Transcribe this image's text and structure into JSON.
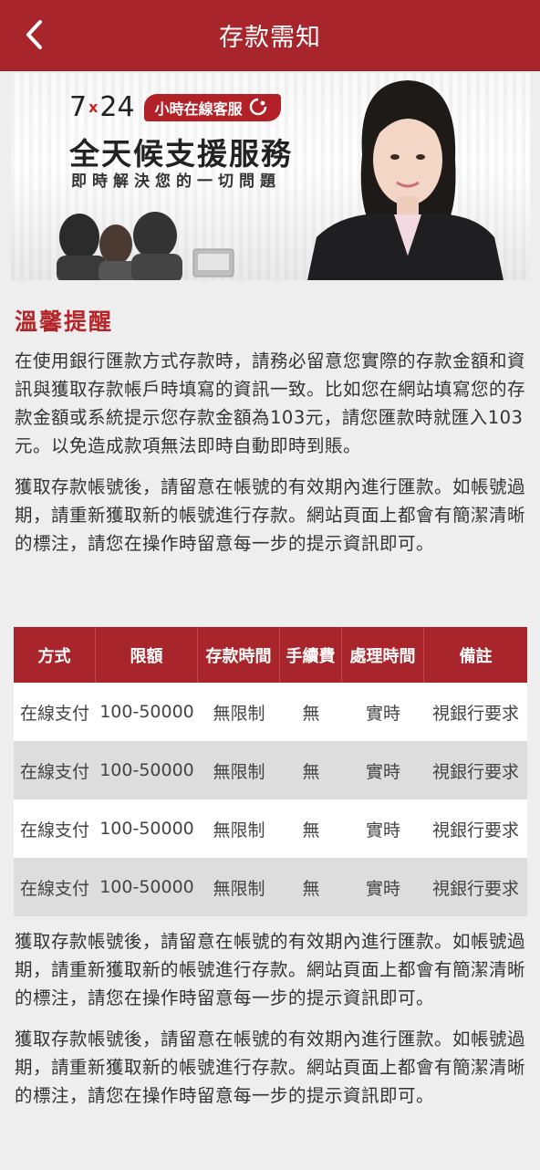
{
  "header": {
    "title": "存款需知",
    "back_icon": "chevron-left-icon"
  },
  "banner": {
    "line1_seven": "7",
    "line1_x": "x",
    "line1_24": "24",
    "line1_pill": "小時在線客服",
    "line2": "全天候支援服務",
    "line3": "即時解決您的一切問題"
  },
  "notice": {
    "title": "溫馨提醒",
    "paragraphs": [
      "在使用銀行匯款方式存款時，請務必留意您實際的存款金額和資訊與獲取存款帳戶時填寫的資訊一致。比如您在網站填寫您的存款金額或系統提示您存款金額為103元，請您匯款時就匯入103元。以免造成款項無法即時自動即時到賬。",
      "獲取存款帳號後，請留意在帳號的有效期內進行匯款。如帳號過期，請重新獲取新的帳號進行存款。網站頁面上都會有簡潔清晰的標注，請您在操作時留意每一步的提示資訊即可。"
    ]
  },
  "table": {
    "headers": [
      "方式",
      "限額",
      "存款時間",
      "手續費",
      "處理時間",
      "備註"
    ],
    "rows": [
      [
        "在線支付",
        "100-50000",
        "無限制",
        "無",
        "實時",
        "視銀行要求"
      ],
      [
        "在線支付",
        "100-50000",
        "無限制",
        "無",
        "實時",
        "視銀行要求"
      ],
      [
        "在線支付",
        "100-50000",
        "無限制",
        "無",
        "實時",
        "視銀行要求"
      ],
      [
        "在線支付",
        "100-50000",
        "無限制",
        "無",
        "實時",
        "視銀行要求"
      ]
    ]
  },
  "footer_notes": [
    "獲取存款帳號後，請留意在帳號的有效期內進行匯款。如帳號過期，請重新獲取新的帳號進行存款。網站頁面上都會有簡潔清晰的標注，請您在操作時留意每一步的提示資訊即可。",
    "獲取存款帳號後，請留意在帳號的有效期內進行匯款。如帳號過期，請重新獲取新的帳號進行存款。網站頁面上都會有簡潔清晰的標注，請您在操作時留意每一步的提示資訊即可。"
  ],
  "colors": {
    "brand_red": "#a8262b",
    "title_red": "#b5262b",
    "row_alt": "#dddddd"
  }
}
